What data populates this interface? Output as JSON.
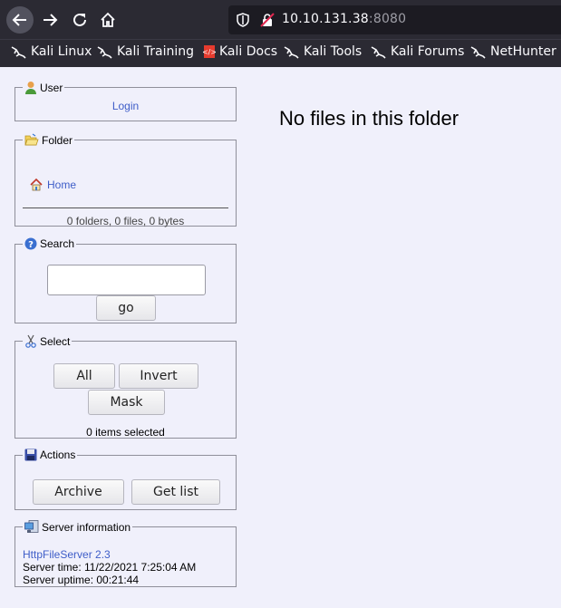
{
  "browser": {
    "url_host": "10.10.131.38",
    "url_port": ":8080",
    "bookmarks": [
      "Kali Linux",
      "Kali Training",
      "Kali Docs",
      "Kali Tools",
      "Kali Forums",
      "NetHunter"
    ]
  },
  "sidebar": {
    "user": {
      "title": "User",
      "login": "Login"
    },
    "folder": {
      "title": "Folder",
      "home": "Home",
      "stats": "0 folders, 0 files, 0 bytes"
    },
    "search": {
      "title": "Search",
      "input_value": "",
      "go": "go"
    },
    "select": {
      "title": "Select",
      "all": "All",
      "invert": "Invert",
      "mask": "Mask",
      "count": "0 items selected"
    },
    "actions": {
      "title": "Actions",
      "archive": "Archive",
      "get_list": "Get list"
    },
    "server": {
      "title": "Server information",
      "link": "HttpFileServer 2.3",
      "time": "Server time: 11/22/2021 7:25:04 AM",
      "uptime": "Server uptime: 00:21:44"
    }
  },
  "main": {
    "message": "No files in this folder"
  }
}
